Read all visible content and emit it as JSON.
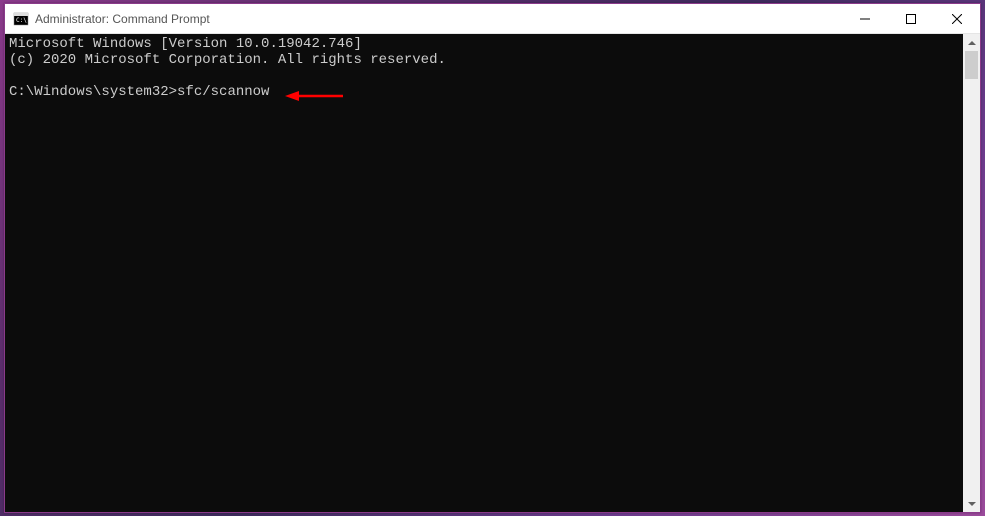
{
  "window": {
    "title": "Administrator: Command Prompt"
  },
  "console": {
    "line1": "Microsoft Windows [Version 10.0.19042.746]",
    "line2": "(c) 2020 Microsoft Corporation. All rights reserved.",
    "blank": "",
    "prompt": "C:\\Windows\\system32>",
    "command": "sfc/scannow"
  },
  "annotation": {
    "color": "#ff0000"
  }
}
